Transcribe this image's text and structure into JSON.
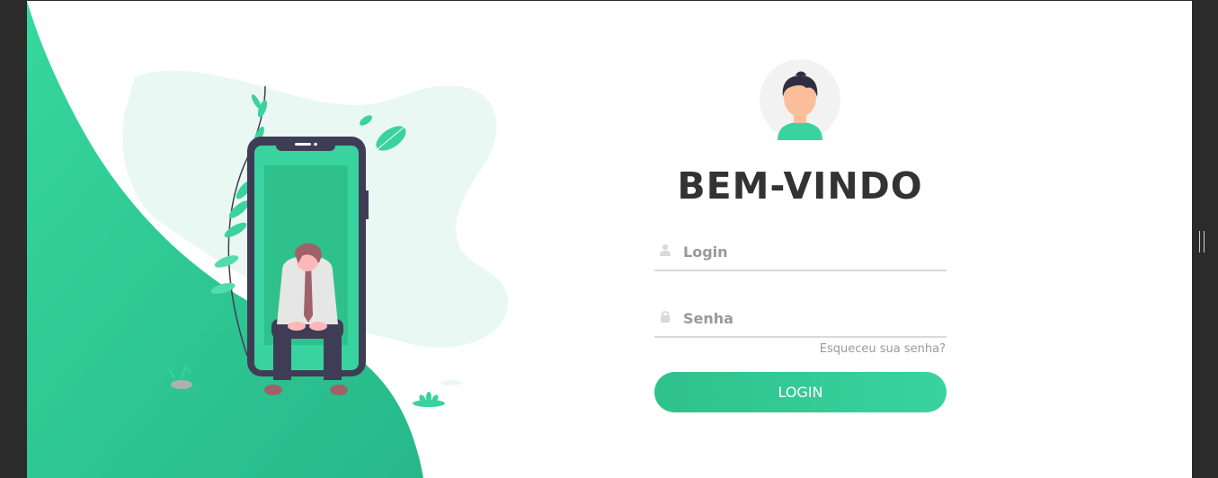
{
  "colors": {
    "accent": "#38d39f",
    "accent_dark": "#2fc18c",
    "title": "#333333",
    "muted": "#999999",
    "blob": "#eaf8f3",
    "phone": "#3f3d56"
  },
  "welcome": {
    "title": "BEM-VINDO"
  },
  "form": {
    "login_placeholder": "Login",
    "password_placeholder": "Senha",
    "forgot_link": "Esqueceu sua senha?",
    "submit_label": "LOGIN"
  },
  "icons": {
    "user": "user-icon",
    "lock": "lock-icon",
    "avatar": "avatar-icon"
  }
}
